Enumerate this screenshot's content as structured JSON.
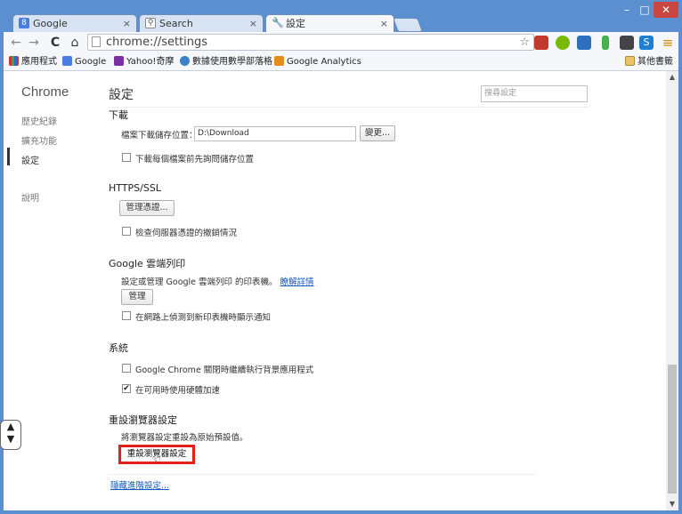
{
  "window": {
    "minimize": "–",
    "maximize": "□",
    "close": "✕"
  },
  "tabs": [
    {
      "label": "Google",
      "icon": "google-icon",
      "close": "×",
      "active": false
    },
    {
      "label": "Search",
      "icon": "search-icon",
      "close": "×",
      "active": false
    },
    {
      "label": "設定",
      "icon": "wrench-icon",
      "close": "×",
      "active": true
    }
  ],
  "toolbar": {
    "back": "←",
    "forward": "→",
    "reload": "C",
    "home": "⌂",
    "url": "chrome://settings",
    "star": "☆",
    "menu": "≡"
  },
  "bookmarks": {
    "apps": "應用程式",
    "items": [
      "Google",
      "Yahoo!奇摩",
      "數據使用數學部落格",
      "Google Analytics"
    ],
    "other": "其他書籤"
  },
  "sidebar": {
    "title": "Chrome",
    "items": [
      "歷史紀錄",
      "擴充功能",
      "設定",
      "說明"
    ],
    "selected": "設定"
  },
  "main": {
    "title": "設定",
    "search_placeholder": "搜尋設定"
  },
  "downloads": {
    "title": "下載",
    "location_label": "檔案下載儲存位置：",
    "location_value": "D:\\Download",
    "change_button": "變更...",
    "ask_label": "下載每個檔案前先詢問儲存位置",
    "ask_checked": false
  },
  "https": {
    "title": "HTTPS/SSL",
    "manage_button": "管理憑證...",
    "revocation_label": "檢查伺服器憑證的撤銷情況",
    "revocation_checked": false
  },
  "cloud_print": {
    "title": "Google 雲端列印",
    "desc": "設定或管理 Google 雲端列印 的印表機。",
    "learn_more": "瞭解詳情",
    "manage_button": "管理",
    "notify_label": "在網路上偵測到新印表機時顯示通知",
    "notify_checked": false
  },
  "system": {
    "title": "系統",
    "background_label": "Google Chrome 關閉時繼續執行背景應用程式",
    "background_checked": false,
    "hw_accel_label": "在可用時使用硬體加速",
    "hw_accel_checked": true
  },
  "reset": {
    "title": "重設瀏覽器設定",
    "desc": "將瀏覽器設定重設為原始預設值。",
    "button": "重設瀏覽器設定"
  },
  "footer": {
    "hide_advanced": "隱藏進階設定..."
  },
  "checkmark": "✔",
  "colors": {
    "frame": "#5b8fcf",
    "highlight": "#e2201b",
    "link": "#1558bb"
  }
}
